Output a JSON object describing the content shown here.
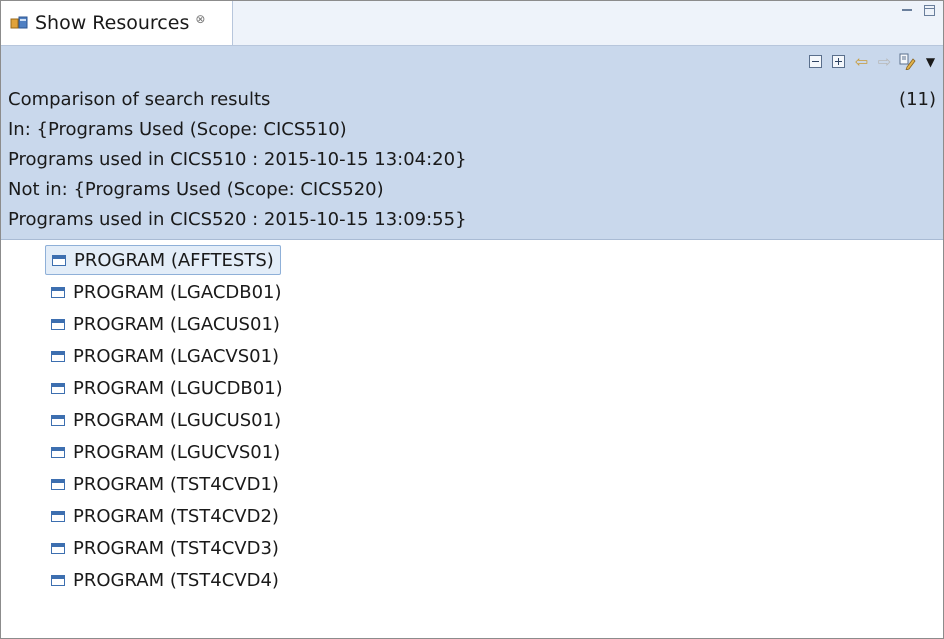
{
  "tab": {
    "title": "Show Resources",
    "close_glyph": "⊗"
  },
  "window_controls": [
    "minimize",
    "maximize"
  ],
  "toolbar": {
    "buttons": [
      "collapse-all",
      "expand-all",
      "back",
      "forward",
      "highlight",
      "view-menu"
    ]
  },
  "header": {
    "line1": "Comparison of search results",
    "count": "(11)",
    "line2": "In: {Programs Used (Scope: CICS510)",
    "line3": "Programs used in CICS510 : 2015-10-15 13:04:20}",
    "line4": "Not in: {Programs Used (Scope: CICS520)",
    "line5": "Programs used in CICS520 : 2015-10-15 13:09:55}"
  },
  "results": [
    {
      "label": "PROGRAM (AFFTESTS)",
      "selected": true
    },
    {
      "label": "PROGRAM (LGACDB01)",
      "selected": false
    },
    {
      "label": "PROGRAM (LGACUS01)",
      "selected": false
    },
    {
      "label": "PROGRAM (LGACVS01)",
      "selected": false
    },
    {
      "label": "PROGRAM (LGUCDB01)",
      "selected": false
    },
    {
      "label": "PROGRAM (LGUCUS01)",
      "selected": false
    },
    {
      "label": "PROGRAM (LGUCVS01)",
      "selected": false
    },
    {
      "label": "PROGRAM (TST4CVD1)",
      "selected": false
    },
    {
      "label": "PROGRAM (TST4CVD2)",
      "selected": false
    },
    {
      "label": "PROGRAM (TST4CVD3)",
      "selected": false
    },
    {
      "label": "PROGRAM (TST4CVD4)",
      "selected": false
    }
  ],
  "colors": {
    "header_bg": "#c9d8ec",
    "selection_bg": "#e3edf8",
    "resource_icon": "#3d6fb0"
  }
}
